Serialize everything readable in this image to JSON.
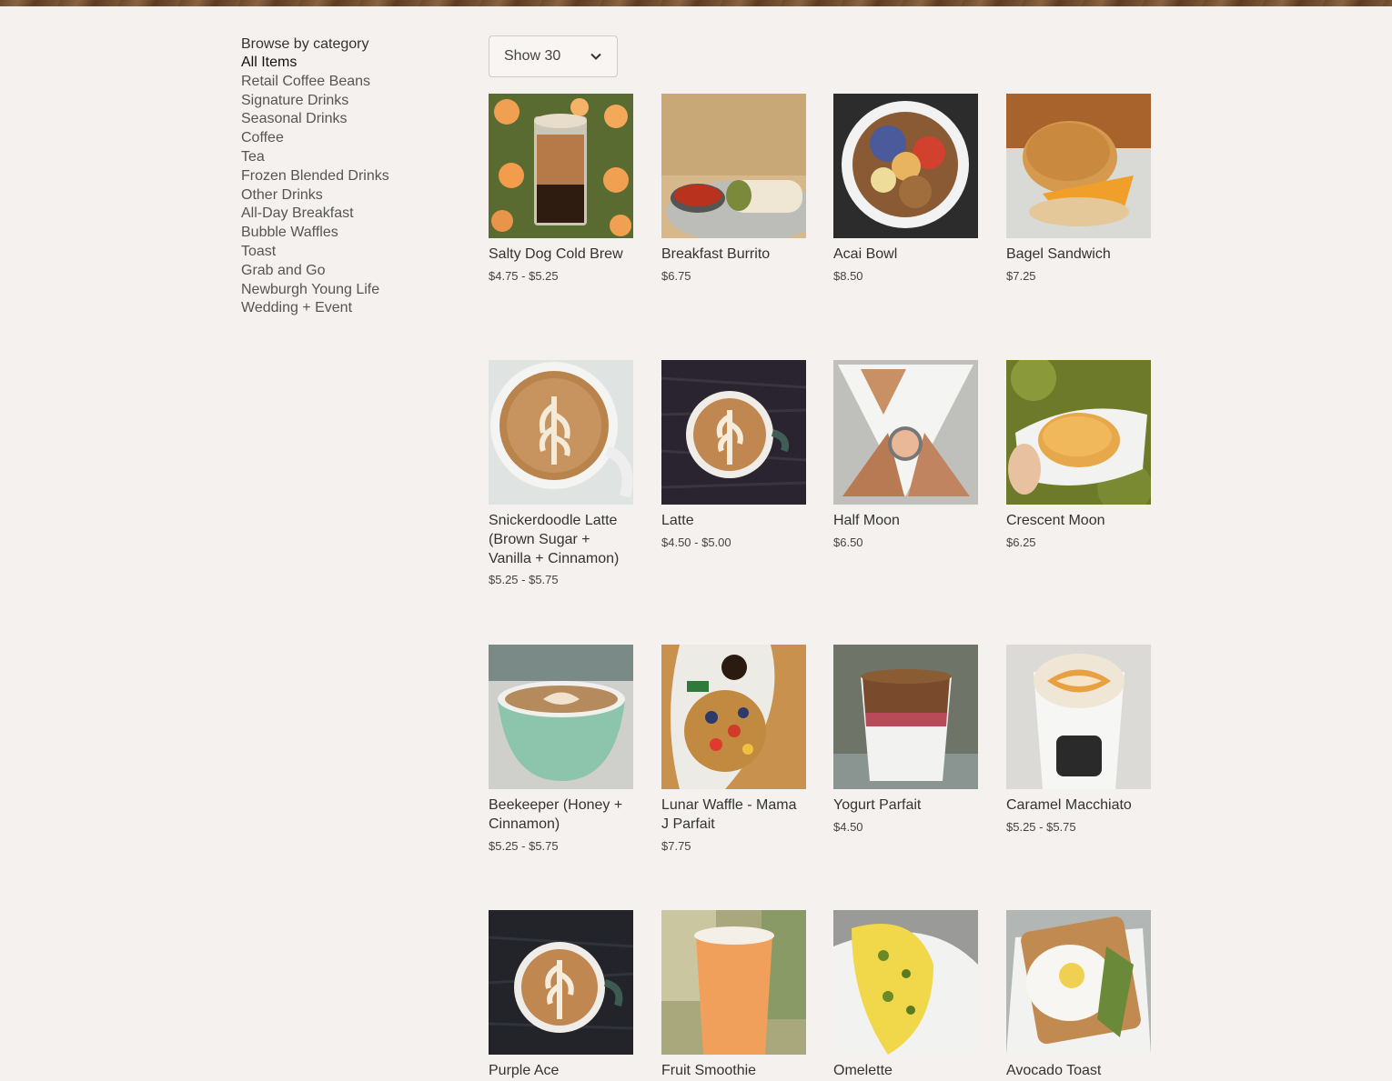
{
  "sidebar": {
    "heading": "Browse by category",
    "items": [
      {
        "label": "All Items",
        "active": true
      },
      {
        "label": "Retail Coffee Beans"
      },
      {
        "label": "Signature Drinks"
      },
      {
        "label": "Seasonal Drinks"
      },
      {
        "label": "Coffee"
      },
      {
        "label": "Tea"
      },
      {
        "label": "Frozen Blended Drinks"
      },
      {
        "label": "Other Drinks"
      },
      {
        "label": "All-Day Breakfast"
      },
      {
        "label": "Bubble Waffles"
      },
      {
        "label": "Toast"
      },
      {
        "label": "Grab and Go"
      },
      {
        "label": "Newburgh Young Life"
      },
      {
        "label": "Wedding + Event"
      }
    ]
  },
  "toolbar": {
    "show_label": "Show 30"
  },
  "products": [
    {
      "name": "Salty Dog Cold Brew",
      "price": "$4.75 - $5.25",
      "image": "iced-coffee-cup-flowers"
    },
    {
      "name": "Breakfast Burrito",
      "price": "$6.75",
      "image": "burrito-with-salsa"
    },
    {
      "name": "Acai Bowl",
      "price": "$8.50",
      "image": "acai-bowl-berries"
    },
    {
      "name": "Bagel Sandwich",
      "price": "$7.25",
      "image": "bagel-egg-cheese"
    },
    {
      "name": "Snickerdoodle Latte (Brown Sugar + Vanilla + Cinnamon)",
      "price": "$5.25 - $5.75",
      "image": "latte-art-mug"
    },
    {
      "name": "Latte",
      "price": "$4.50 - $5.00",
      "image": "latte-art-dark"
    },
    {
      "name": "Half Moon",
      "price": "$6.50",
      "image": "quesadilla-triangles"
    },
    {
      "name": "Crescent Moon",
      "price": "$6.25",
      "image": "croissant-sandwich"
    },
    {
      "name": "Beekeeper (Honey + Cinnamon)",
      "price": "$5.25 - $5.75",
      "image": "green-cup-latte"
    },
    {
      "name": "Lunar Waffle - Mama J Parfait",
      "price": "$7.75",
      "image": "waffle-berries"
    },
    {
      "name": "Yogurt Parfait",
      "price": "$4.50",
      "image": "yogurt-parfait-cup"
    },
    {
      "name": "Caramel Macchiato",
      "price": "$5.25 - $5.75",
      "image": "caramel-macchiato-cup"
    },
    {
      "name": "Purple Ace",
      "price": "",
      "image": "latte-art-dark"
    },
    {
      "name": "Fruit Smoothie",
      "price": "",
      "image": "smoothie-cup"
    },
    {
      "name": "Omelette",
      "price": "",
      "image": "omelette-plate"
    },
    {
      "name": "Avocado Toast",
      "price": "",
      "image": "avocado-toast-egg"
    }
  ],
  "colors": {
    "background": "#f5f1ee",
    "text": "#333333",
    "active": "#111111"
  }
}
